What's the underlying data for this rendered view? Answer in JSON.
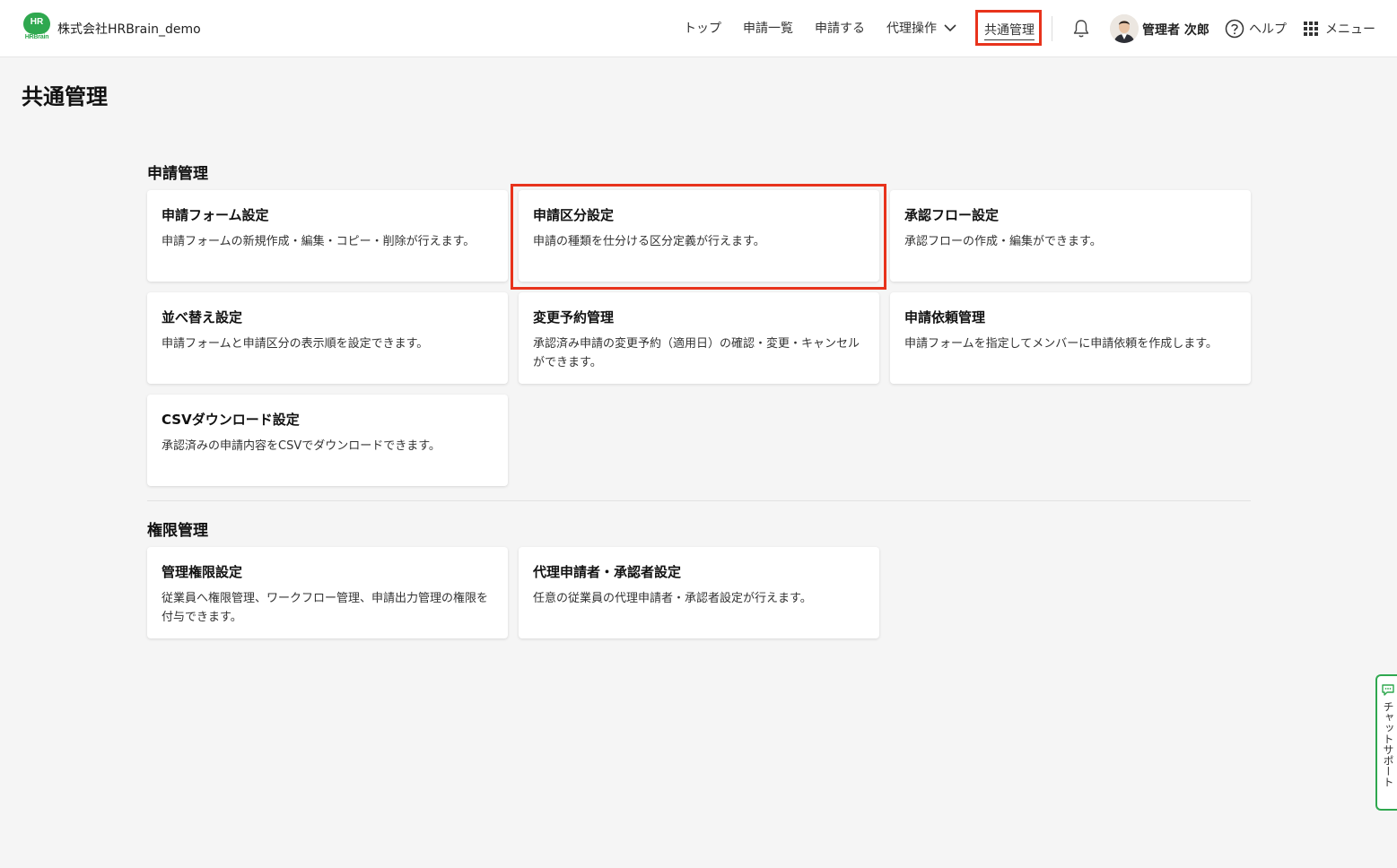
{
  "header": {
    "logo_mark": "HR",
    "logo_text": "HRBrain",
    "company": "株式会社HRBrain_demo",
    "nav": {
      "top": "トップ",
      "list": "申請一覧",
      "apply": "申請する",
      "proxy": "代理操作",
      "common": "共通管理"
    },
    "user_name": "管理者 次郎",
    "help": "ヘルプ",
    "menu": "メニュー"
  },
  "page": {
    "title": "共通管理"
  },
  "sections": {
    "application": {
      "title": "申請管理",
      "cards": [
        {
          "title": "申請フォーム設定",
          "desc": "申請フォームの新規作成・編集・コピー・削除が行えます。"
        },
        {
          "title": "申請区分設定",
          "desc": "申請の種類を仕分ける区分定義が行えます。"
        },
        {
          "title": "承認フロー設定",
          "desc": "承認フローの作成・編集ができます。"
        },
        {
          "title": "並べ替え設定",
          "desc": "申請フォームと申請区分の表示順を設定できます。"
        },
        {
          "title": "変更予約管理",
          "desc": "承認済み申請の変更予約（適用日）の確認・変更・キャンセルができます。"
        },
        {
          "title": "申請依頼管理",
          "desc": "申請フォームを指定してメンバーに申請依頼を作成します。"
        },
        {
          "title": "CSVダウンロード設定",
          "desc": "承認済みの申請内容をCSVでダウンロードできます。"
        }
      ]
    },
    "permission": {
      "title": "権限管理",
      "cards": [
        {
          "title": "管理権限設定",
          "desc": "従業員へ権限管理、ワークフロー管理、申請出力管理の権限を付与できます。"
        },
        {
          "title": "代理申請者・承認者設定",
          "desc": "任意の従業員の代理申請者・承認者設定が行えます。"
        }
      ]
    }
  },
  "chat_support": "チャットサポート",
  "colors": {
    "brand": "#2fa84f",
    "highlight": "#e8331c"
  }
}
